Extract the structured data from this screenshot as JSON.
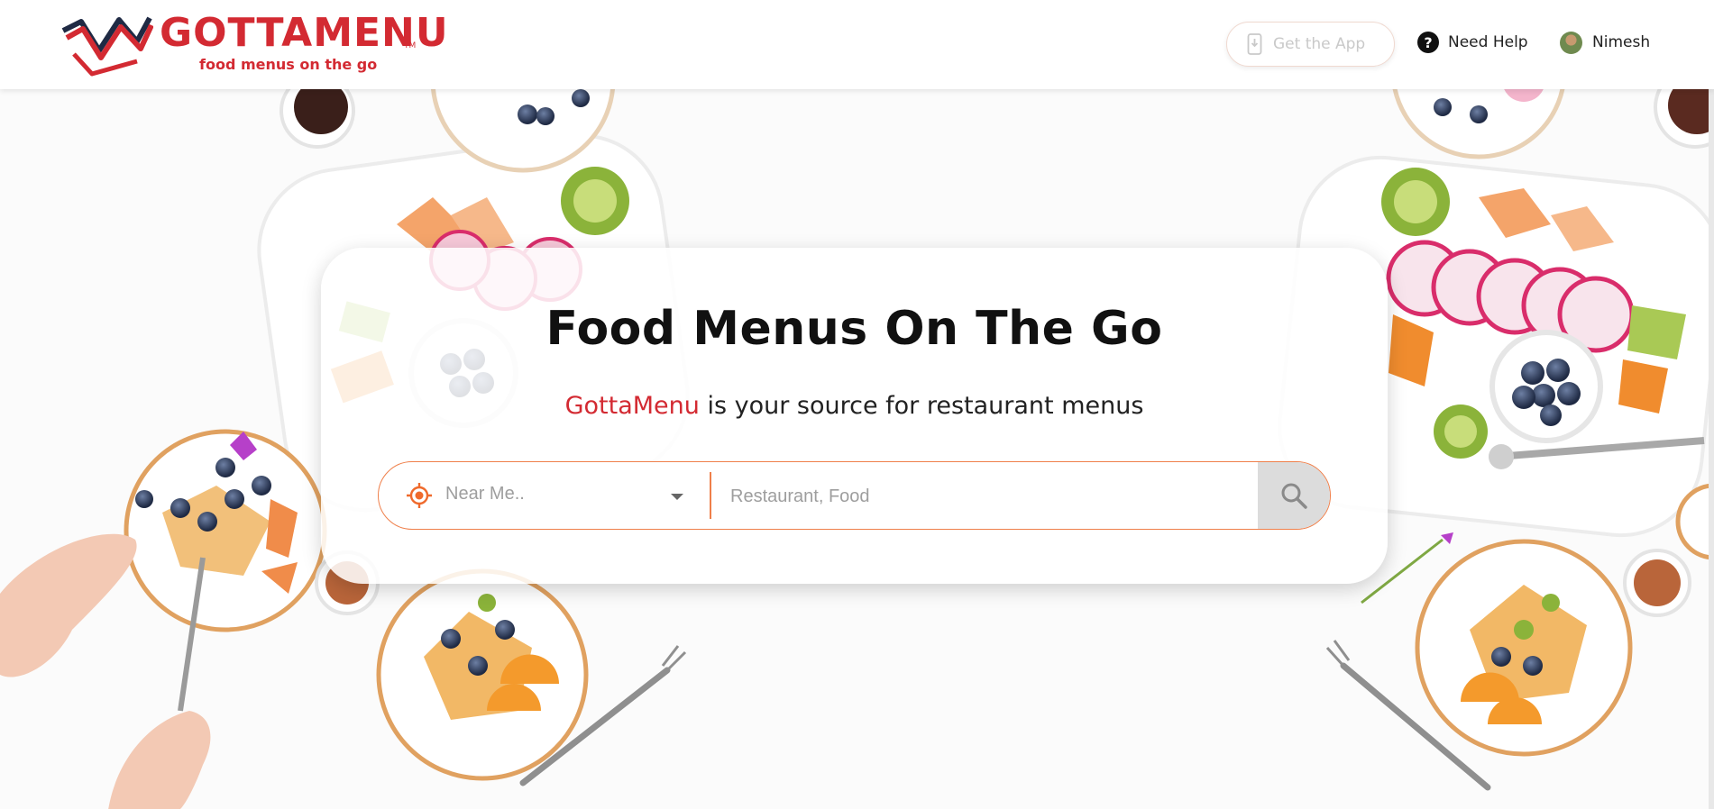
{
  "header": {
    "logo": {
      "name": "GOTTAMENU",
      "tm": "TM",
      "tagline": "food menus on the go"
    },
    "get_app_label": "Get the App",
    "help_label": "Need Help",
    "help_glyph": "?",
    "user_name": "Nimesh"
  },
  "hero": {
    "title": "Food Menus On The Go",
    "subtitle_brand": "GottaMenu",
    "subtitle_rest": " is your source for restaurant menus",
    "search": {
      "location_value": "Near Me..",
      "query_placeholder": "Restaurant, Food"
    }
  },
  "colors": {
    "brand_red": "#d32a32",
    "accent_orange": "#ef7f4a",
    "search_button_bg": "#dcdcdc"
  },
  "icons": [
    "logo-mark-icon",
    "phone-download-icon",
    "help-circle-icon",
    "avatar",
    "crosshair-location-icon",
    "dropdown-caret-icon",
    "search-icon"
  ]
}
